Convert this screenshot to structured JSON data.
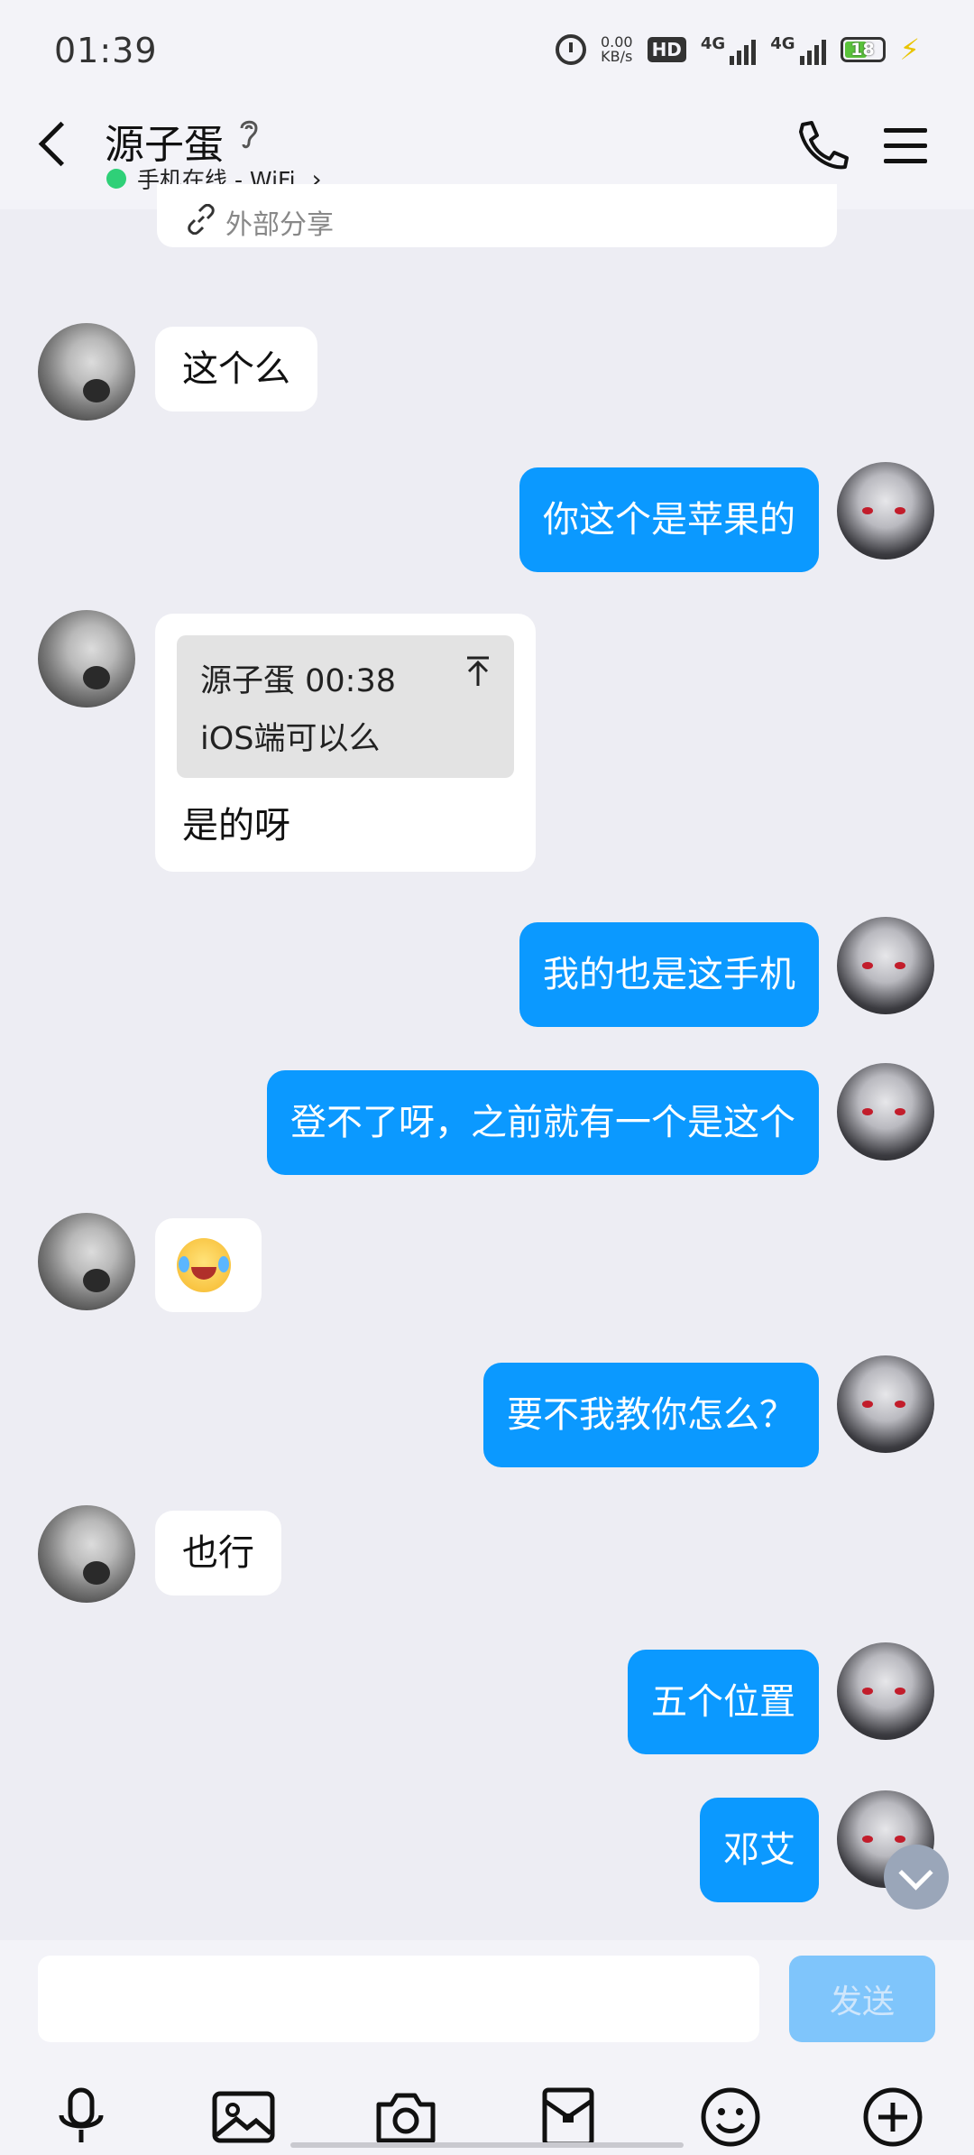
{
  "status_bar": {
    "time": "01:39",
    "net_speed_value": "0.00",
    "net_speed_unit": "KB/s",
    "hd_label": "HD",
    "signal1_label": "4G",
    "signal2_label": "4G",
    "battery": "18"
  },
  "header": {
    "name": "源子蛋",
    "status": "手机在线 - WiFi",
    "status_arrow": "›"
  },
  "share_card": {
    "text": "外部分享"
  },
  "messages": [
    {
      "side": "them",
      "text": "这个么"
    },
    {
      "side": "me",
      "text": "你这个是苹果的"
    },
    {
      "side": "them",
      "quote_sender_time": "源子蛋 00:38",
      "quote_text": "iOS端可以么",
      "text": "是的呀"
    },
    {
      "side": "me",
      "text": "我的也是这手机"
    },
    {
      "side": "me",
      "text": "登不了呀，之前就有一个是这个"
    },
    {
      "side": "them",
      "emoji": "laughing-with-tears"
    },
    {
      "side": "me",
      "text": "要不我教你怎么？"
    },
    {
      "side": "them",
      "text": "也行"
    },
    {
      "side": "me",
      "text": "五个位置"
    },
    {
      "side": "me",
      "text": "邓艾"
    }
  ],
  "composer": {
    "input_value": "",
    "send_label": "发送"
  },
  "toolbar_icons": [
    "microphone-icon",
    "image-icon",
    "camera-icon",
    "red-packet-icon",
    "emoji-icon",
    "plus-icon"
  ]
}
